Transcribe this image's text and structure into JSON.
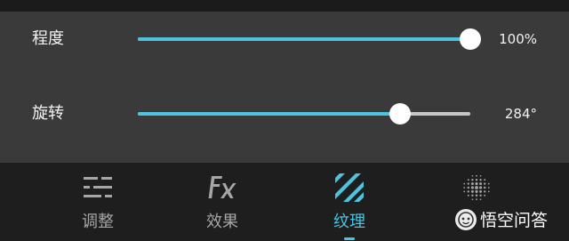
{
  "sliders": [
    {
      "label": "程度",
      "value_text": "100%",
      "fraction": 1.0
    },
    {
      "label": "旋转",
      "value_text": "284°",
      "fraction": 0.79
    }
  ],
  "tabs": [
    {
      "label": "调整",
      "icon": "sliders-icon",
      "active": false
    },
    {
      "label": "效果",
      "icon": "fx-icon",
      "active": false
    },
    {
      "label": "纹理",
      "icon": "stripes-texture-icon",
      "active": true
    },
    {
      "label": "",
      "icon": "dot-grid-icon",
      "active": false
    }
  ],
  "watermark": {
    "text": "悟空问答",
    "logo": "wukong-logo"
  },
  "colors": {
    "accent": "#4ec3df",
    "panel": "#3a3a3a",
    "tabbar": "#1e1e1e"
  }
}
